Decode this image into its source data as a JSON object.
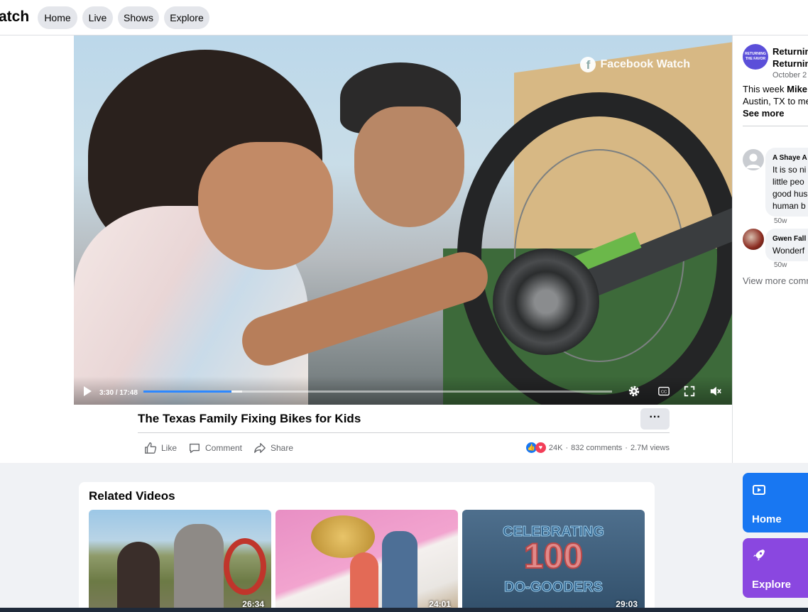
{
  "nav": {
    "brand": "atch",
    "tabs": [
      "Home",
      "Live",
      "Shows",
      "Explore"
    ]
  },
  "video": {
    "watermark": "Facebook Watch",
    "time": "3:30 / 17:48",
    "progress": 0.188,
    "buffered": 0.21
  },
  "post": {
    "title": "The Texas Family Fixing Bikes for Kids",
    "more": "···",
    "actions": {
      "like": "Like",
      "comment": "Comment",
      "share": "Share"
    },
    "reactions": "24K",
    "comments": "832 comments",
    "views": "2.7M views",
    "sep": "·"
  },
  "side": {
    "avatar_text": "RETURNING THE FAVOR",
    "page_name_1": "Returning",
    "page_name_2": "Returning",
    "date": "October 2",
    "desc_1_prefix": "This week ",
    "desc_1_bold": "Mike",
    "desc_2": "Austin, TX to me",
    "see_more": "See more",
    "comments": [
      {
        "name": "A Shaye A",
        "lines": [
          "It is so ni",
          "little peo",
          "good hus",
          "human b"
        ],
        "time": "50w"
      },
      {
        "name": "Gwen Fall",
        "lines": [
          "Wonderf"
        ],
        "time": "50w"
      }
    ],
    "view_more": "View more comm"
  },
  "related": {
    "heading": "Related Videos",
    "items": [
      {
        "duration": "26:34"
      },
      {
        "duration": "24:01"
      },
      {
        "duration": "29:03",
        "overlay_1": "CELEBRATING",
        "overlay_2": "100",
        "overlay_3": "DO-GOODERS"
      }
    ]
  },
  "fabs": [
    {
      "label": "Home",
      "color": "#1877f2"
    },
    {
      "label": "Explore",
      "color": "#8a47e0"
    }
  ],
  "colors": {
    "accent": "#1877f2",
    "explore": "#8a47e0"
  }
}
